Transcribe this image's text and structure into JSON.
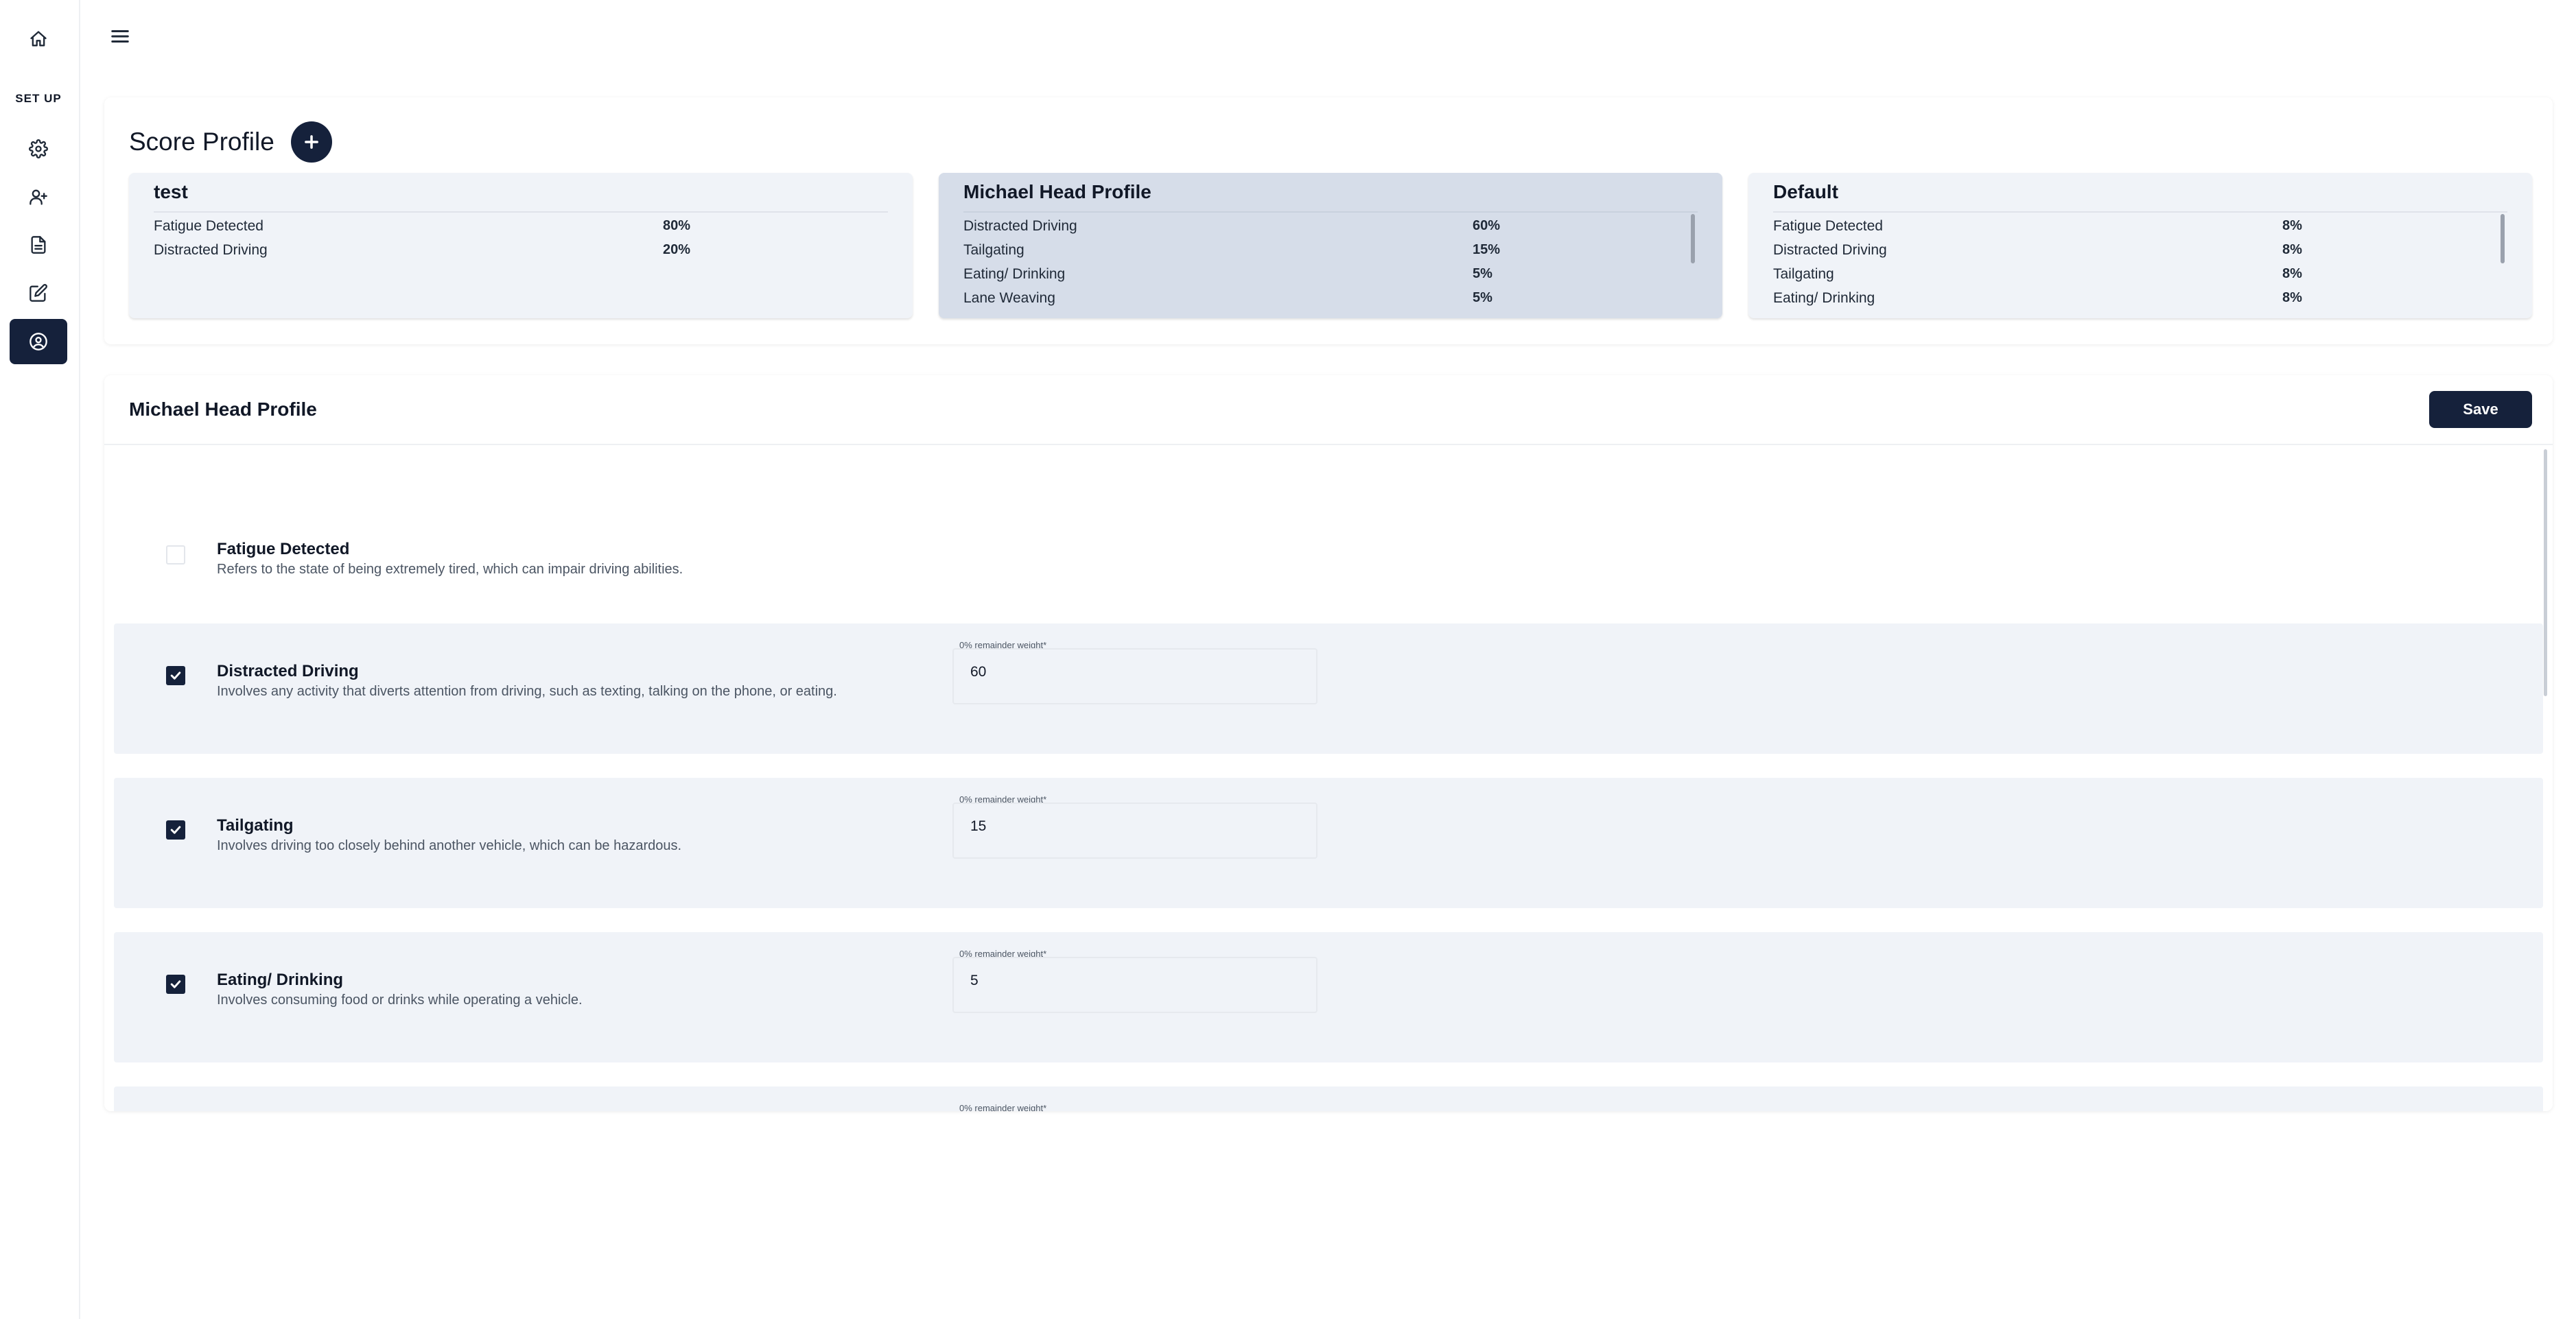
{
  "sidebar": {
    "setup_label": "SET UP",
    "icons": [
      "home-icon",
      "gear-icon",
      "add-user-icon",
      "document-icon",
      "edit-icon",
      "user-circle-icon"
    ],
    "active_item": "user-circle-icon"
  },
  "header": {
    "menu_icon": "hamburger-menu-icon"
  },
  "score_profile": {
    "title": "Score Profile",
    "add_button_icon": "plus-icon",
    "profiles": [
      {
        "name": "test",
        "selected": false,
        "rows": [
          {
            "label": "Fatigue Detected",
            "value": "80%"
          },
          {
            "label": "Distracted Driving",
            "value": "20%"
          }
        ]
      },
      {
        "name": "Michael Head Profile",
        "selected": true,
        "rows": [
          {
            "label": "Distracted Driving",
            "value": "60%"
          },
          {
            "label": "Tailgating",
            "value": "15%"
          },
          {
            "label": "Eating/ Drinking",
            "value": "5%"
          },
          {
            "label": "Lane Weaving",
            "value": "5%"
          }
        ]
      },
      {
        "name": "Default",
        "selected": false,
        "rows": [
          {
            "label": "Fatigue Detected",
            "value": "8%"
          },
          {
            "label": "Distracted Driving",
            "value": "8%"
          },
          {
            "label": "Tailgating",
            "value": "8%"
          },
          {
            "label": "Eating/ Drinking",
            "value": "8%"
          }
        ]
      }
    ]
  },
  "editor": {
    "title": "Michael Head Profile",
    "save_label": "Save",
    "behaviors": [
      {
        "name": "Fatigue Detected",
        "description": "Refers to the state of being extremely tired, which can impair driving abilities.",
        "checked": false
      },
      {
        "name": "Distracted Driving",
        "description": "Involves any activity that diverts attention from driving, such as texting, talking on the phone, or eating.",
        "checked": true,
        "weight_label": "0% remainder weight*",
        "weight": "60"
      },
      {
        "name": "Tailgating",
        "description": "Involves driving too closely behind another vehicle, which can be hazardous.",
        "checked": true,
        "weight_label": "0% remainder weight*",
        "weight": "15"
      },
      {
        "name": "Eating/ Drinking",
        "description": "Involves consuming food or drinks while operating a vehicle.",
        "checked": true,
        "weight_label": "0% remainder weight*",
        "weight": "5"
      },
      {
        "name": "",
        "description": "",
        "checked": true,
        "weight_label": "0% remainder weight*",
        "weight": ""
      }
    ]
  }
}
